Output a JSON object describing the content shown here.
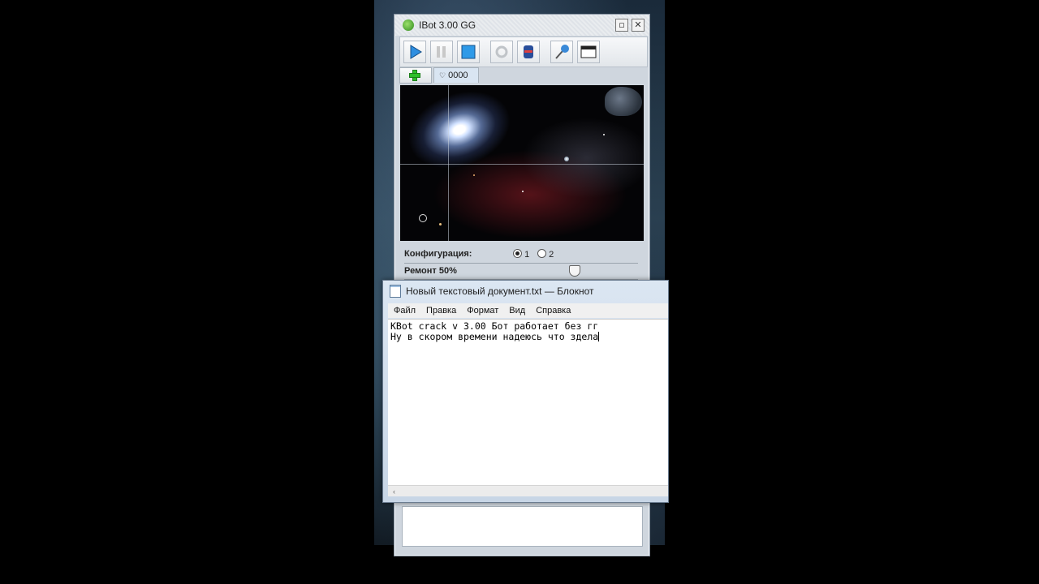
{
  "kbot": {
    "title": "IBot 3.00 GG",
    "window_buttons": {
      "restore": "▫",
      "close": "✕"
    },
    "toolbar": [
      {
        "name": "play-button",
        "icon": "play-icon"
      },
      {
        "name": "pause-button",
        "icon": "pause-icon"
      },
      {
        "name": "stop-button",
        "icon": "stop-icon"
      },
      {
        "name": "tool-disabled-button",
        "icon": "gear-icon"
      },
      {
        "name": "database-button",
        "icon": "database-icon"
      },
      {
        "name": "pin-button",
        "icon": "pin-icon"
      },
      {
        "name": "console-button",
        "icon": "console-icon"
      }
    ],
    "tab_label": "0000",
    "config_label": "Конфигурация:",
    "config_options": [
      "1",
      "2"
    ],
    "config_selected": "1",
    "repair_label": "Ремонт 50%",
    "repair_value": 0.5
  },
  "notepad": {
    "title": "Новый текстовый документ.txt — Блокнот",
    "menu": [
      "Файл",
      "Правка",
      "Формат",
      "Вид",
      "Справка"
    ],
    "line1": "KBot crack v 3.00 Бот работает без гг",
    "line2": "Ну в скором времени надеюсь что здела",
    "scroll_arrow": "‹"
  }
}
